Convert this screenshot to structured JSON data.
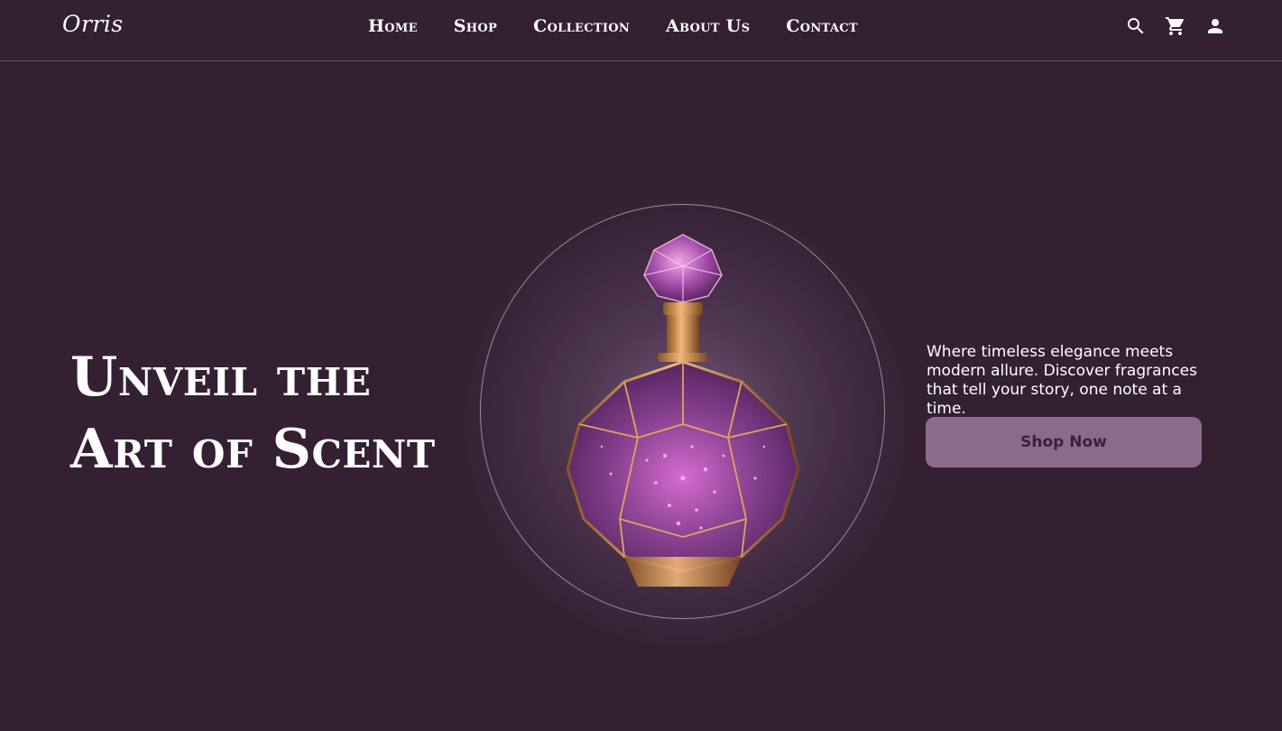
{
  "brand": {
    "logo": "Orris"
  },
  "nav": {
    "links": [
      {
        "label": "Home"
      },
      {
        "label": "Shop"
      },
      {
        "label": "Collection"
      },
      {
        "label": "About Us"
      },
      {
        "label": "Contact"
      }
    ],
    "icons": [
      "search-icon",
      "cart-icon",
      "user-icon"
    ]
  },
  "hero": {
    "title_line1": "Unveil the",
    "title_line2": "Art of Scent",
    "tagline": "Where timeless elegance meets modern allure. Discover fragrances that tell your story, one note at a time.",
    "cta_label": "Shop Now"
  },
  "colors": {
    "background": "#341f33",
    "button": "#8b6b8b",
    "button_text": "#3a2139",
    "bottle_purple": "#7a3f86",
    "bottle_gold": "#c98a4a"
  }
}
